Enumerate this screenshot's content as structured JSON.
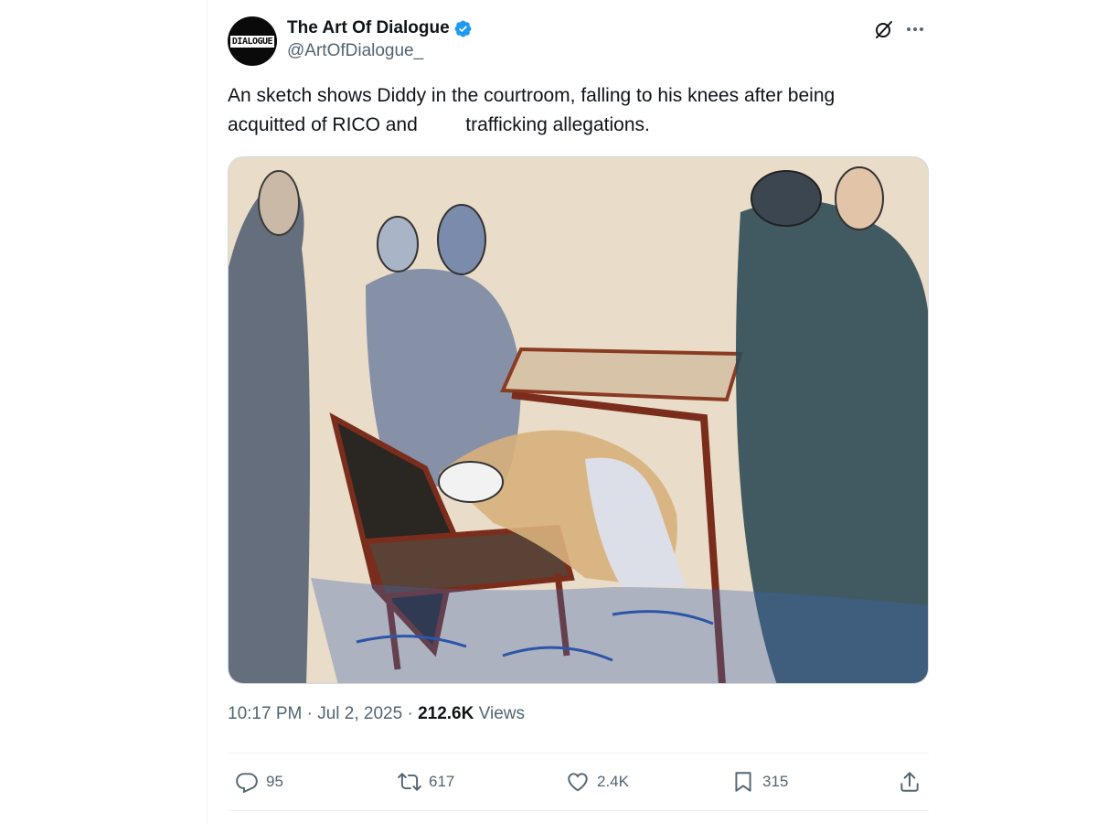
{
  "author": {
    "display_name": "The Art Of Dialogue",
    "handle": "@ArtOfDialogue_",
    "avatar_text": "DIALOGUE",
    "verified": true
  },
  "header": {
    "grok_icon": "grok-icon",
    "more_icon": "more-icon"
  },
  "tweet": {
    "text": "An sketch shows Diddy in the courtroom, falling to his knees after being\nacquitted of RICO and         trafficking allegations."
  },
  "media": {
    "type": "courtroom sketch image"
  },
  "meta": {
    "time": "10:17 PM",
    "separator": "·",
    "date": "Jul 2, 2025",
    "views_count": "212.6K",
    "views_label": "Views"
  },
  "actions": {
    "replies": "95",
    "reposts": "617",
    "likes": "2.4K",
    "bookmarks": "315"
  },
  "colors": {
    "text_primary": "#0f1419",
    "text_secondary": "#536471",
    "verified": "#1d9bf0",
    "border": "#eff3f4"
  }
}
